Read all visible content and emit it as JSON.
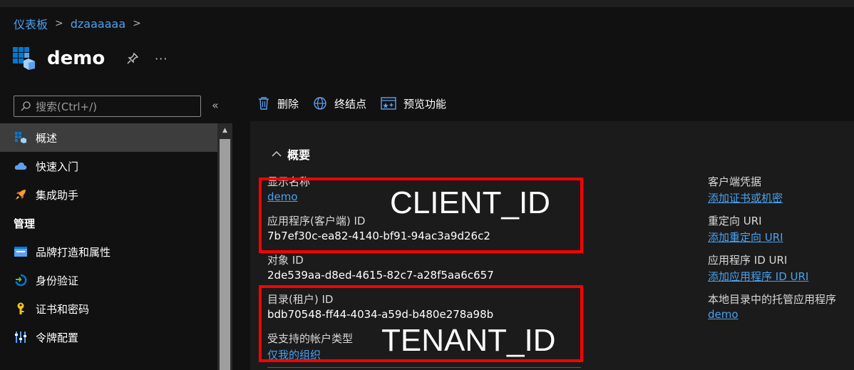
{
  "breadcrumb": {
    "items": [
      "仪表板",
      "dzaaaaaa"
    ],
    "separator": ">"
  },
  "header": {
    "title": "demo",
    "more": "···"
  },
  "sidebar": {
    "search_placeholder": "搜索(Ctrl+/)",
    "collapse": "«",
    "items": [
      {
        "label": "概述",
        "icon": "app-grid-icon",
        "active": true
      },
      {
        "label": "快速入门",
        "icon": "cloud-icon"
      },
      {
        "label": "集成助手",
        "icon": "rocket-icon"
      }
    ],
    "section": "管理",
    "manage_items": [
      {
        "label": "品牌打造和属性",
        "icon": "branding-icon"
      },
      {
        "label": "身份验证",
        "icon": "auth-icon"
      },
      {
        "label": "证书和密码",
        "icon": "key-icon"
      },
      {
        "label": "令牌配置",
        "icon": "token-config-icon"
      }
    ]
  },
  "toolbar": {
    "delete": "删除",
    "endpoints": "终结点",
    "preview": "预览功能"
  },
  "overview": {
    "heading": "概要",
    "display_name_label": "显示名称",
    "display_name_value": "demo",
    "client_id_label": "应用程序(客户端) ID",
    "client_id_value": "7b7ef30c-ea82-4140-bf91-94ac3a9d26c2",
    "object_id_label": "对象 ID",
    "object_id_value": "2de539aa-d8ed-4615-82c7-a28f5aa6c657",
    "tenant_id_label": "目录(租户) ID",
    "tenant_id_value": "bdb70548-ff44-4034-a59d-b480e278a98b",
    "account_types_label": "受支持的帐户类型",
    "account_types_value": "仅我的组织"
  },
  "right_column": {
    "credentials_label": "客户端凭据",
    "credentials_link": "添加证书或机密",
    "redirect_label": "重定向 URI",
    "redirect_link": "添加重定向 URI",
    "app_id_uri_label": "应用程序 ID URI",
    "app_id_uri_link": "添加应用程序 ID URI",
    "managed_app_label": "本地目录中的托管应用程序",
    "managed_app_link": "demo"
  },
  "annotations": {
    "client_id": "CLIENT_ID",
    "tenant_id": "TENANT_ID"
  },
  "colors": {
    "link": "#4aa1f0",
    "annotation": "#ff0000",
    "azure_blue": "#0078d4"
  }
}
